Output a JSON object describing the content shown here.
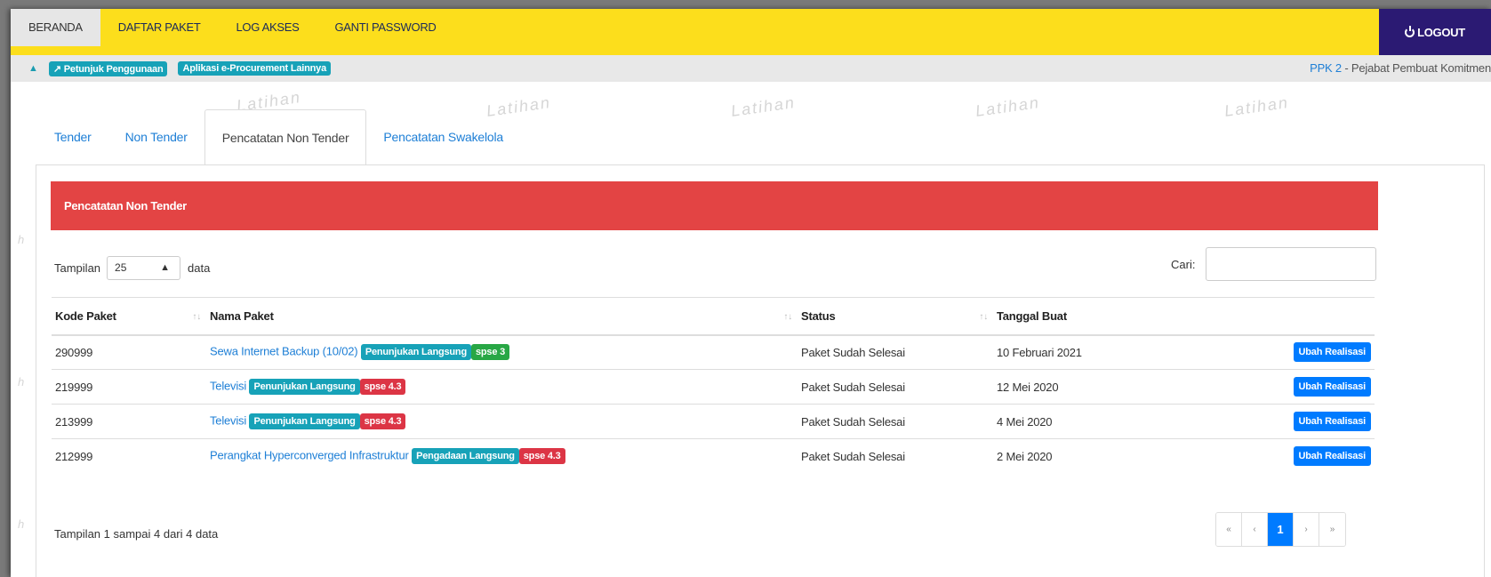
{
  "nav": {
    "items": [
      "BERANDA",
      "DAFTAR PAKET",
      "LOG AKSES",
      "GANTI PASSWORD"
    ],
    "logout": "LOGOUT"
  },
  "infobar": {
    "guide_badge": "↗ Petunjuk Penggunaan",
    "eproc_badge": "Aplikasi e-Procurement Lainnya",
    "role_code": "PPK 2",
    "role_label": " - Pejabat Pembuat Komitmen"
  },
  "watermark_text": "Latihan",
  "tabs": [
    "Tender",
    "Non Tender",
    "Pencatatan Non Tender",
    "Pencatatan Swakelola"
  ],
  "panel": {
    "title": "Pencatatan Non Tender",
    "length_prefix": "Tampilan",
    "length_value": "25",
    "length_suffix": "data",
    "search_label": "Cari:",
    "search_value": ""
  },
  "table": {
    "headers": [
      "Kode Paket",
      "Nama Paket",
      "Status",
      "Tanggal Buat"
    ],
    "rows": [
      {
        "kode": "290999",
        "nama": "Sewa Internet Backup (10/02)",
        "tipe": "Penunjukan Langsung",
        "versi": "spse 3",
        "status": "Paket Sudah Selesai",
        "tanggal": "10 Februari 2021",
        "aksi": "Ubah Realisasi"
      },
      {
        "kode": "219999",
        "nama": "Televisi",
        "tipe": "Penunjukan Langsung",
        "versi": "spse 4.3",
        "status": "Paket Sudah Selesai",
        "tanggal": "12 Mei 2020",
        "aksi": "Ubah Realisasi"
      },
      {
        "kode": "213999",
        "nama": "Televisi",
        "tipe": "Penunjukan Langsung",
        "versi": "spse 4.3",
        "status": "Paket Sudah Selesai",
        "tanggal": "4 Mei 2020",
        "aksi": "Ubah Realisasi"
      },
      {
        "kode": "212999",
        "nama": "Perangkat Hyperconverged Infrastruktur",
        "tipe": "Pengadaan Langsung",
        "versi": "spse 4.3",
        "status": "Paket Sudah Selesai",
        "tanggal": "2 Mei 2020",
        "aksi": "Ubah Realisasi"
      }
    ]
  },
  "footer": {
    "info": "Tampilan 1 sampai 4 dari 4 data",
    "pager": [
      "«",
      "‹",
      "1",
      "›",
      "»"
    ]
  },
  "colors": {
    "nav_bg": "#fcde1c",
    "logout_bg": "#2b1a73",
    "header_red": "#e34444",
    "link_blue": "#1e7fd6",
    "badge_teal": "#17a2b8",
    "badge_green": "#28a745",
    "badge_red": "#dc3545",
    "button_blue": "#007bff"
  }
}
